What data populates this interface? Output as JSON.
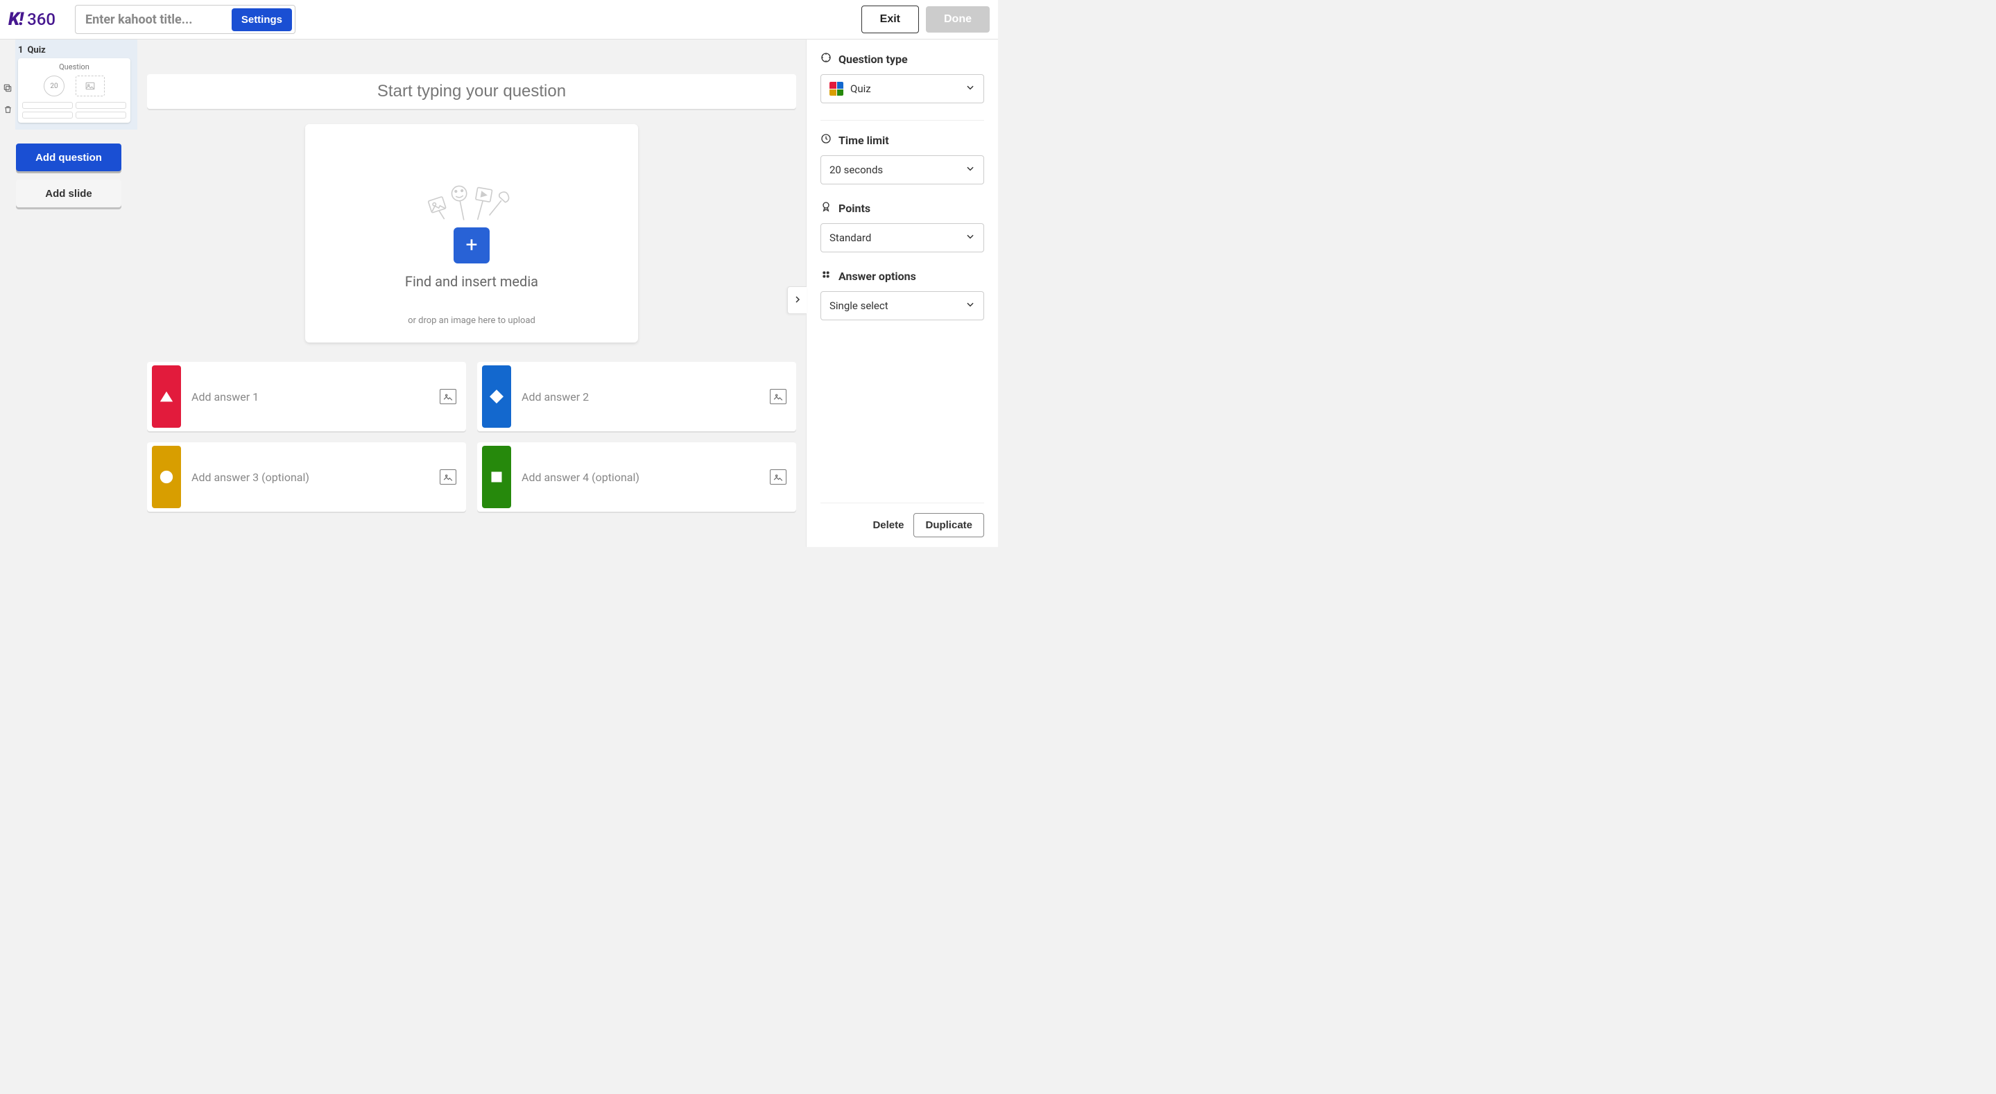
{
  "header": {
    "logo_suffix": "360",
    "title_placeholder": "Enter kahoot title...",
    "settings": "Settings",
    "exit": "Exit",
    "done": "Done"
  },
  "sidebar": {
    "slide_index": "1",
    "slide_type": "Quiz",
    "thumb_title": "Question",
    "thumb_time": "20",
    "add_question": "Add question",
    "add_slide": "Add slide"
  },
  "editor": {
    "question_placeholder": "Start typing your question",
    "media_prompt": "Find and insert media",
    "media_drop_hint": "or drop an image here to upload",
    "answers": [
      {
        "placeholder": "Add answer 1",
        "shape": "triangle",
        "color": "red"
      },
      {
        "placeholder": "Add answer 2",
        "shape": "diamond",
        "color": "blue"
      },
      {
        "placeholder": "Add answer 3 (optional)",
        "shape": "circle",
        "color": "yellow"
      },
      {
        "placeholder": "Add answer 4 (optional)",
        "shape": "square",
        "color": "green"
      }
    ]
  },
  "panel": {
    "question_type_label": "Question type",
    "question_type_value": "Quiz",
    "time_limit_label": "Time limit",
    "time_limit_value": "20 seconds",
    "points_label": "Points",
    "points_value": "Standard",
    "answer_options_label": "Answer options",
    "answer_options_value": "Single select",
    "delete": "Delete",
    "duplicate": "Duplicate"
  }
}
